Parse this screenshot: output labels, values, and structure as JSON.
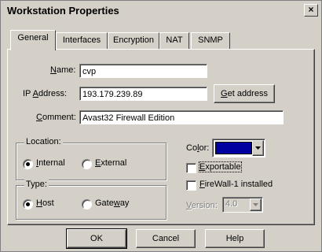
{
  "window": {
    "title": "Workstation Properties",
    "close_glyph": "×"
  },
  "tabs": [
    {
      "label": "General"
    },
    {
      "label": "Interfaces"
    },
    {
      "label": "Encryption"
    },
    {
      "label": "NAT"
    },
    {
      "label": "SNMP"
    }
  ],
  "fields": {
    "name": {
      "label_u": "N",
      "label_rest": "ame:",
      "value": "cvp"
    },
    "ip": {
      "label_pre": "IP ",
      "label_u": "A",
      "label_rest": "ddress:",
      "value": "193.179.239.89"
    },
    "comment": {
      "label_u": "C",
      "label_rest": "omment:",
      "value": "Avast32 Firewall Edition"
    }
  },
  "get_address": {
    "label_u": "G",
    "label_rest": "et address"
  },
  "location": {
    "legend": "Location:",
    "internal": {
      "label_u": "I",
      "label_rest": "nternal",
      "checked": true
    },
    "external": {
      "label_u": "E",
      "label_rest": "xternal",
      "checked": false
    }
  },
  "type": {
    "legend": "Type:",
    "host": {
      "label_u": "H",
      "label_rest": "ost",
      "checked": true
    },
    "gateway": {
      "label_pre": "Gate",
      "label_u": "w",
      "label_rest": "ay",
      "checked": false
    }
  },
  "color": {
    "label_pre": "Co",
    "label_u": "l",
    "label_rest": "or:",
    "value": "#0000a0",
    "arrow_icon": "dropdown-arrow-icon"
  },
  "exportable": {
    "label_u": "E",
    "label_rest": "xportable",
    "checked": false
  },
  "firewall": {
    "label_u": "F",
    "label_rest": "ireWall-1 installed",
    "checked": false
  },
  "version": {
    "label_u": "V",
    "label_rest": "ersion:",
    "value": "4.0"
  },
  "buttons": {
    "ok": "OK",
    "cancel": "Cancel",
    "help": "Help"
  }
}
